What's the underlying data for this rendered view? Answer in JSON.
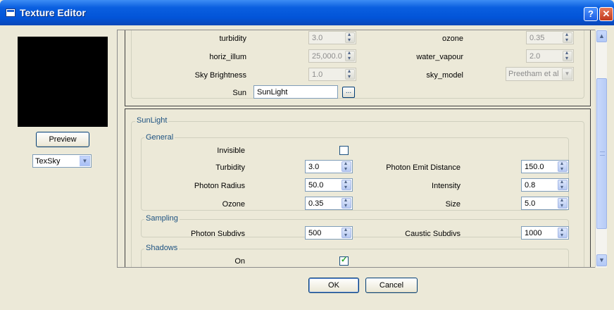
{
  "window": {
    "title": "Texture Editor"
  },
  "left": {
    "preview_button": "Preview",
    "texture_combo_value": "TexSky"
  },
  "top_panel": {
    "turbidity_label": "turbidity",
    "turbidity_value": "3.0",
    "ozone_label": "ozone",
    "ozone_value": "0.35",
    "horiz_illum_label": "horiz_illum",
    "horiz_illum_value": "25,000.0",
    "water_vapour_label": "water_vapour",
    "water_vapour_value": "2.0",
    "sky_brightness_label": "Sky Brightness",
    "sky_brightness_value": "1.0",
    "sky_model_label": "sky_model",
    "sky_model_value": "Preetham et al",
    "sun_label": "Sun",
    "sun_value": "SunLight",
    "sun_browse": "..."
  },
  "sunlight": {
    "title": "SunLight",
    "general": {
      "title": "General",
      "invisible_label": "Invisible",
      "invisible_checked": false,
      "turbidity_label": "Turbidity",
      "turbidity_value": "3.0",
      "photon_emit_distance_label": "Photon Emit Distance",
      "photon_emit_distance_value": "150.0",
      "photon_radius_label": "Photon Radius",
      "photon_radius_value": "50.0",
      "intensity_label": "Intensity",
      "intensity_value": "0.8",
      "ozone_label": "Ozone",
      "ozone_value": "0.35",
      "size_label": "Size",
      "size_value": "5.0"
    },
    "sampling": {
      "title": "Sampling",
      "photon_subdivs_label": "Photon Subdivs",
      "photon_subdivs_value": "500",
      "caustic_subdivs_label": "Caustic Subdivs",
      "caustic_subdivs_value": "1000"
    },
    "shadows": {
      "title": "Shadows",
      "on_label": "On",
      "on_checked": true
    }
  },
  "footer": {
    "ok": "OK",
    "cancel": "Cancel"
  }
}
